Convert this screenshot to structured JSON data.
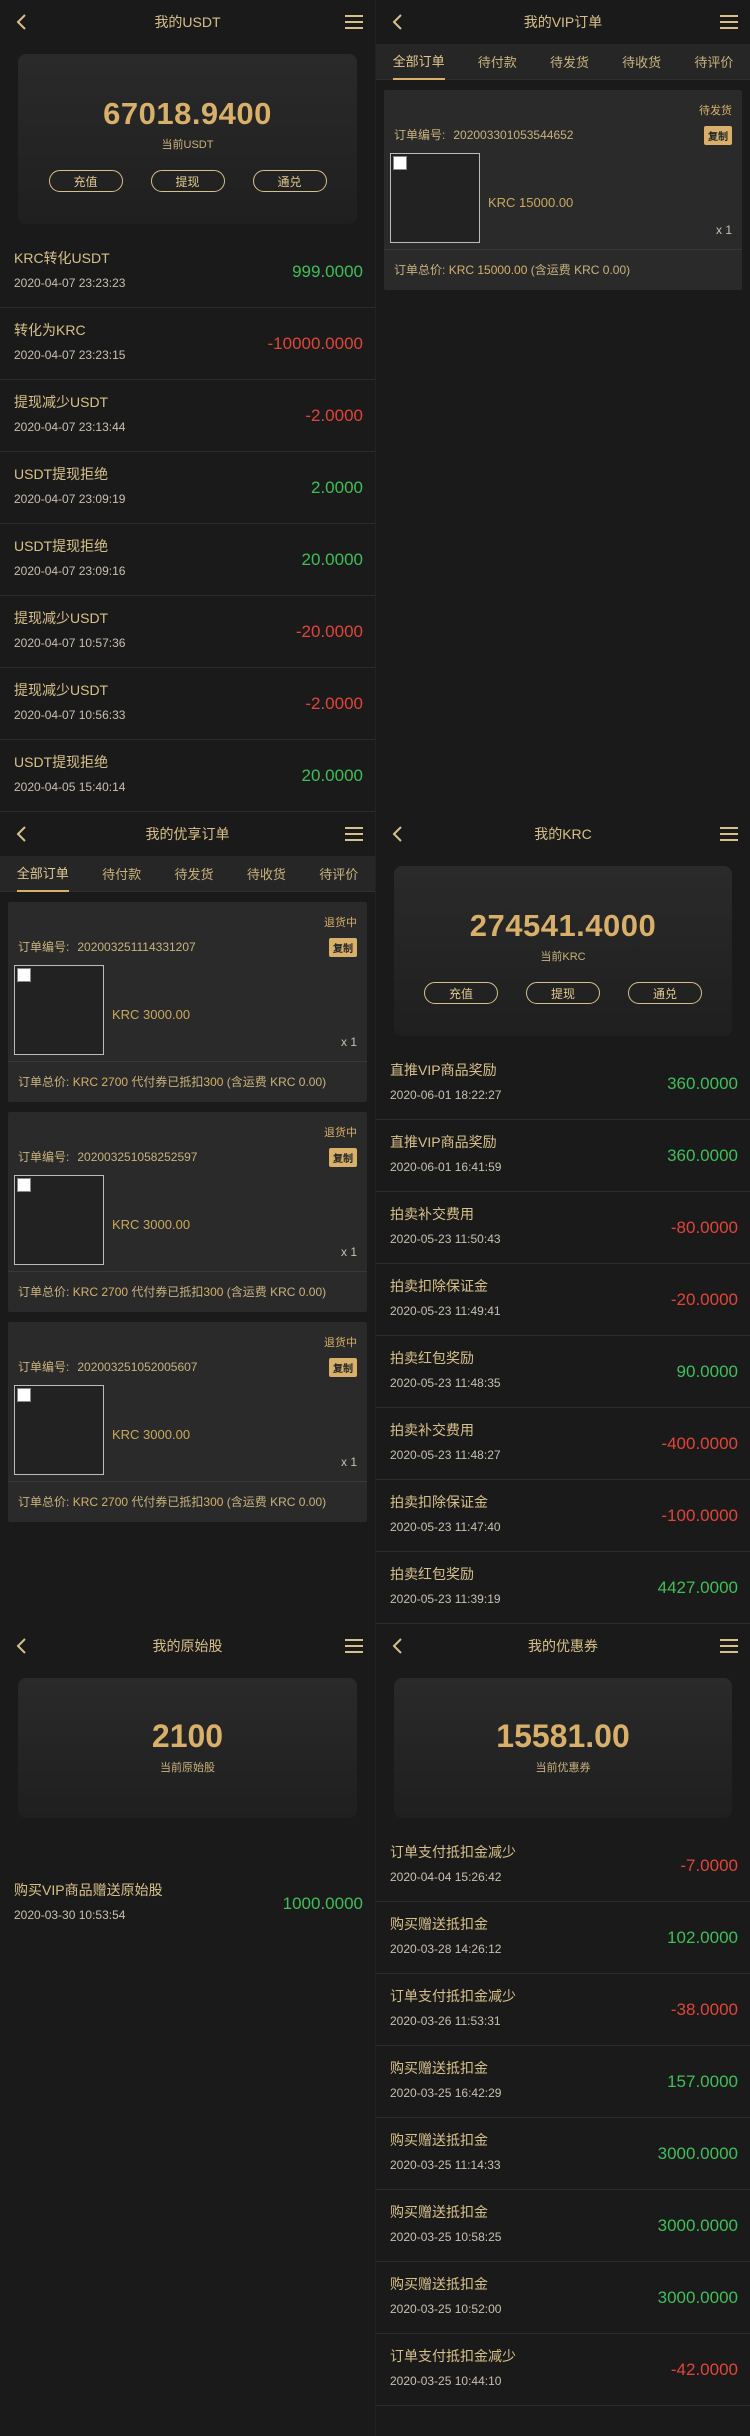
{
  "usdt": {
    "title": "我的USDT",
    "amount": "67018.9400",
    "sub": "当前USDT",
    "buttons": [
      "充值",
      "提现",
      "通兑"
    ],
    "records": [
      {
        "name": "KRC转化USDT",
        "time": "2020-04-07 23:23:23",
        "value": "999.0000",
        "sign": "pos"
      },
      {
        "name": "转化为KRC",
        "time": "2020-04-07 23:23:15",
        "value": "-10000.0000",
        "sign": "neg"
      },
      {
        "name": "提现减少USDT",
        "time": "2020-04-07 23:13:44",
        "value": "-2.0000",
        "sign": "neg"
      },
      {
        "name": "USDT提现拒绝",
        "time": "2020-04-07 23:09:19",
        "value": "2.0000",
        "sign": "pos"
      },
      {
        "name": "USDT提现拒绝",
        "time": "2020-04-07 23:09:16",
        "value": "20.0000",
        "sign": "pos"
      },
      {
        "name": "提现减少USDT",
        "time": "2020-04-07 10:57:36",
        "value": "-20.0000",
        "sign": "neg"
      },
      {
        "name": "提现减少USDT",
        "time": "2020-04-07 10:56:33",
        "value": "-2.0000",
        "sign": "neg"
      },
      {
        "name": "USDT提现拒绝",
        "time": "2020-04-05 15:40:14",
        "value": "20.0000",
        "sign": "pos"
      }
    ]
  },
  "vip": {
    "title": "我的VIP订单",
    "tabs": [
      "全部订单",
      "待付款",
      "待发货",
      "待收货",
      "待评价"
    ],
    "order": {
      "status": "待发货",
      "no_label": "订单编号:",
      "no": "202003301053544652",
      "copy": "复制",
      "price": "KRC 15000.00",
      "qty": "x 1",
      "total_label": "订单总价:",
      "total": "KRC 15000.00",
      "total_note": "(含运费 KRC 0.00)"
    }
  },
  "youxiang": {
    "title": "我的优享订单",
    "tabs": [
      "全部订单",
      "待付款",
      "待发货",
      "待收货",
      "待评价"
    ],
    "orders": [
      {
        "status": "退货中",
        "no_label": "订单编号:",
        "no": "202003251114331207",
        "copy": "复制",
        "price": "KRC 3000.00",
        "qty": "x 1",
        "total_label": "订单总价:",
        "total": "KRC 2700",
        "coupon": "代付券已抵扣",
        "coupon_amt": "300",
        "note": "(含运费 KRC 0.00)"
      },
      {
        "status": "退货中",
        "no_label": "订单编号:",
        "no": "202003251058252597",
        "copy": "复制",
        "price": "KRC 3000.00",
        "qty": "x 1",
        "total_label": "订单总价:",
        "total": "KRC 2700",
        "coupon": "代付券已抵扣",
        "coupon_amt": "300",
        "note": "(含运费 KRC 0.00)"
      },
      {
        "status": "退货中",
        "no_label": "订单编号:",
        "no": "202003251052005607",
        "copy": "复制",
        "price": "KRC 3000.00",
        "qty": "x 1",
        "total_label": "订单总价:",
        "total": "KRC 2700",
        "coupon": "代付券已抵扣",
        "coupon_amt": "300",
        "note": "(含运费 KRC 0.00)"
      }
    ]
  },
  "krc": {
    "title": "我的KRC",
    "amount": "274541.4000",
    "sub": "当前KRC",
    "buttons": [
      "充值",
      "提现",
      "通兑"
    ],
    "records": [
      {
        "name": "直推VIP商品奖励",
        "time": "2020-06-01 18:22:27",
        "value": "360.0000",
        "sign": "pos"
      },
      {
        "name": "直推VIP商品奖励",
        "time": "2020-06-01 16:41:59",
        "value": "360.0000",
        "sign": "pos"
      },
      {
        "name": "拍卖补交费用",
        "time": "2020-05-23 11:50:43",
        "value": "-80.0000",
        "sign": "neg"
      },
      {
        "name": "拍卖扣除保证金",
        "time": "2020-05-23 11:49:41",
        "value": "-20.0000",
        "sign": "neg"
      },
      {
        "name": "拍卖红包奖励",
        "time": "2020-05-23 11:48:35",
        "value": "90.0000",
        "sign": "pos"
      },
      {
        "name": "拍卖补交费用",
        "time": "2020-05-23 11:48:27",
        "value": "-400.0000",
        "sign": "neg"
      },
      {
        "name": "拍卖扣除保证金",
        "time": "2020-05-23 11:47:40",
        "value": "-100.0000",
        "sign": "neg"
      },
      {
        "name": "拍卖红包奖励",
        "time": "2020-05-23 11:39:19",
        "value": "4427.0000",
        "sign": "pos"
      }
    ]
  },
  "yuanshi": {
    "title": "我的原始股",
    "amount": "2100",
    "sub": "当前原始股",
    "records": [
      {
        "name": "购买VIP商品赠送原始股",
        "time": "2020-03-30 10:53:54",
        "value": "1000.0000",
        "sign": "pos"
      }
    ]
  },
  "coupon": {
    "title": "我的优惠券",
    "amount": "15581.00",
    "sub": "当前优惠券",
    "records": [
      {
        "name": "订单支付抵扣金减少",
        "time": "2020-04-04 15:26:42",
        "value": "-7.0000",
        "sign": "neg"
      },
      {
        "name": "购买赠送抵扣金",
        "time": "2020-03-28 14:26:12",
        "value": "102.0000",
        "sign": "pos"
      },
      {
        "name": "订单支付抵扣金减少",
        "time": "2020-03-26 11:53:31",
        "value": "-38.0000",
        "sign": "neg"
      },
      {
        "name": "购买赠送抵扣金",
        "time": "2020-03-25 16:42:29",
        "value": "157.0000",
        "sign": "pos"
      },
      {
        "name": "购买赠送抵扣金",
        "time": "2020-03-25 11:14:33",
        "value": "3000.0000",
        "sign": "pos"
      },
      {
        "name": "购买赠送抵扣金",
        "time": "2020-03-25 10:58:25",
        "value": "3000.0000",
        "sign": "pos"
      },
      {
        "name": "购买赠送抵扣金",
        "time": "2020-03-25 10:52:00",
        "value": "3000.0000",
        "sign": "pos"
      },
      {
        "name": "订单支付抵扣金减少",
        "time": "2020-03-25 10:44:10",
        "value": "-42.0000",
        "sign": "neg"
      }
    ]
  },
  "icons": {
    "back": "chevron-left-icon",
    "menu": "hamburger-menu-icon"
  },
  "colors": {
    "gold": "#d8b06a",
    "positive": "#3fbf5a",
    "negative": "#e0453a",
    "bg": "#1a1a1a"
  }
}
